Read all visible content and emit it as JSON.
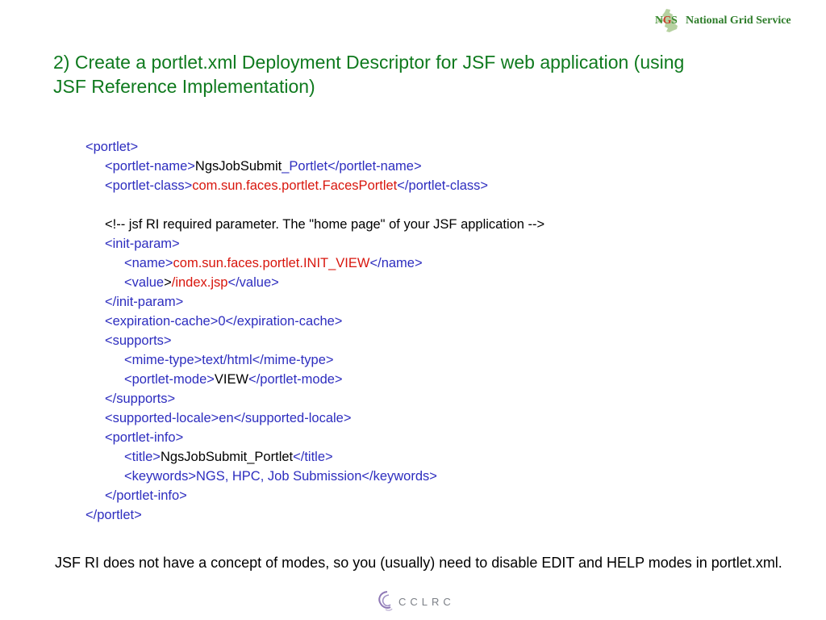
{
  "logo": {
    "abbreviation_parts": [
      "N",
      "G",
      "S"
    ],
    "full_name": "National Grid Service",
    "icon": "uk-map-icon",
    "colors": {
      "green": "#2e7d2a",
      "red": "#c93c2a"
    }
  },
  "slide": {
    "title": "2) Create a portlet.xml Deployment Descriptor for JSF web application (using JSF Reference Implementation)",
    "note": "JSF RI does not have a concept of modes, so you (usually) need to disable EDIT and HELP modes in portlet.xml.",
    "colors": {
      "title": "#0f7a1e",
      "tag": "#2d2dbf",
      "value_red": "#d8160d"
    }
  },
  "code": {
    "open_portlet": "<portlet>",
    "portlet_name_open": "<portlet-name>",
    "portlet_name_value_a": "NgsJobSubmit",
    "portlet_name_value_b": "_Portlet",
    "portlet_name_close": "</portlet-name>",
    "portlet_class_open": "<portlet-class>",
    "portlet_class_value": "com.sun.faces.portlet.FacesPortlet",
    "portlet_class_close": "</portlet-class>",
    "comment": "<!-- jsf RI required parameter. The \"home page\" of your JSF application -->",
    "init_param_open": "<init-param>",
    "name_open": "<name>",
    "name_value": "com.sun.faces.portlet.INIT_VIEW",
    "name_close": "</name>",
    "value_open": "<value",
    "value_gt": ">",
    "value_value": "/index.jsp",
    "value_close": "</value>",
    "init_param_close": "</init-param>",
    "expiration_cache": "<expiration-cache>0</expiration-cache>",
    "supports_open": "<supports>",
    "mime_type": "<mime-type>text/html</mime-type>",
    "portlet_mode_open": "<portlet-mode>",
    "portlet_mode_value": "VIEW",
    "portlet_mode_close": "</portlet-mode>",
    "supports_close": "</supports>",
    "supported_locale": "<supported-locale>en</supported-locale>",
    "portlet_info_open": "<portlet-info>",
    "title_open": "<title>",
    "title_value": "NgsJobSubmit_Portlet",
    "title_close": "</title>",
    "keywords": "<keywords>NGS, HPC, Job Submission</keywords>",
    "portlet_info_close": "</portlet-info>",
    "close_portlet": "</portlet>"
  },
  "footer_logo": {
    "text": "CCLRC",
    "icon": "cclrc-swirl-icon"
  }
}
